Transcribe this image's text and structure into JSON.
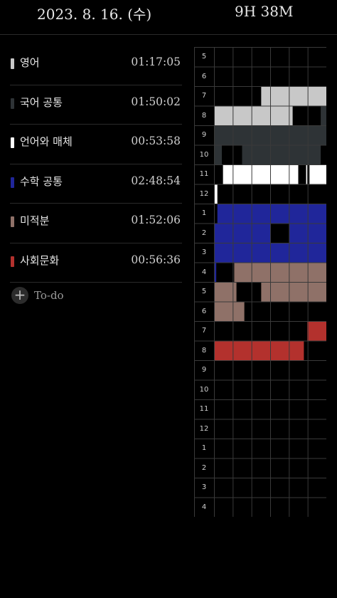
{
  "header": {
    "date": "2023. 8. 16. (수)",
    "total": "9H 38M"
  },
  "subjects": [
    {
      "name": "영어",
      "time": "01:17:05",
      "color": "#c8c8c8"
    },
    {
      "name": "국어 공통",
      "time": "01:50:02",
      "color": "#2e3336"
    },
    {
      "name": "언어와 매체",
      "time": "00:53:58",
      "color": "#ffffff"
    },
    {
      "name": "수학 공통",
      "time": "02:48:54",
      "color": "#20269a"
    },
    {
      "name": "미적분",
      "time": "01:52:06",
      "color": "#8f7168"
    },
    {
      "name": "사회문화",
      "time": "00:56:36",
      "color": "#b3312d"
    }
  ],
  "todo": {
    "label": "To-do"
  },
  "timetable": {
    "hours": [
      "5",
      "6",
      "7",
      "8",
      "9",
      "10",
      "11",
      "12",
      "1",
      "2",
      "3",
      "4",
      "5",
      "6",
      "7",
      "8",
      "9",
      "10",
      "11",
      "12",
      "1",
      "2",
      "3",
      "4"
    ],
    "blocks": [
      {
        "subject": 0,
        "hour": 2,
        "start": 0.42,
        "end": 1.0
      },
      {
        "subject": 0,
        "hour": 3,
        "start": 0.0,
        "end": 0.7
      },
      {
        "subject": 1,
        "hour": 3,
        "start": 0.95,
        "end": 1.0
      },
      {
        "subject": 1,
        "hour": 4,
        "start": 0.0,
        "end": 1.0
      },
      {
        "subject": 1,
        "hour": 5,
        "start": 0.0,
        "end": 0.07
      },
      {
        "subject": 1,
        "hour": 5,
        "start": 0.25,
        "end": 0.95
      },
      {
        "subject": 2,
        "hour": 6,
        "start": 0.08,
        "end": 0.75
      },
      {
        "subject": 2,
        "hour": 6,
        "start": 0.82,
        "end": 0.83
      },
      {
        "subject": 2,
        "hour": 6,
        "start": 0.85,
        "end": 1.0
      },
      {
        "subject": 2,
        "hour": 7,
        "start": 0.0,
        "end": 0.03
      },
      {
        "subject": 3,
        "hour": 8,
        "start": 0.03,
        "end": 1.0
      },
      {
        "subject": 3,
        "hour": 9,
        "start": 0.0,
        "end": 0.5
      },
      {
        "subject": 3,
        "hour": 9,
        "start": 0.67,
        "end": 1.0
      },
      {
        "subject": 3,
        "hour": 10,
        "start": 0.0,
        "end": 1.0
      },
      {
        "subject": 3,
        "hour": 11,
        "start": 0.0,
        "end": 0.02
      },
      {
        "subject": 4,
        "hour": 11,
        "start": 0.18,
        "end": 1.0
      },
      {
        "subject": 4,
        "hour": 12,
        "start": 0.0,
        "end": 0.2
      },
      {
        "subject": 4,
        "hour": 12,
        "start": 0.42,
        "end": 1.0
      },
      {
        "subject": 4,
        "hour": 13,
        "start": 0.0,
        "end": 0.27
      },
      {
        "subject": 5,
        "hour": 14,
        "start": 0.83,
        "end": 1.0
      },
      {
        "subject": 5,
        "hour": 15,
        "start": 0.0,
        "end": 0.8
      }
    ]
  }
}
